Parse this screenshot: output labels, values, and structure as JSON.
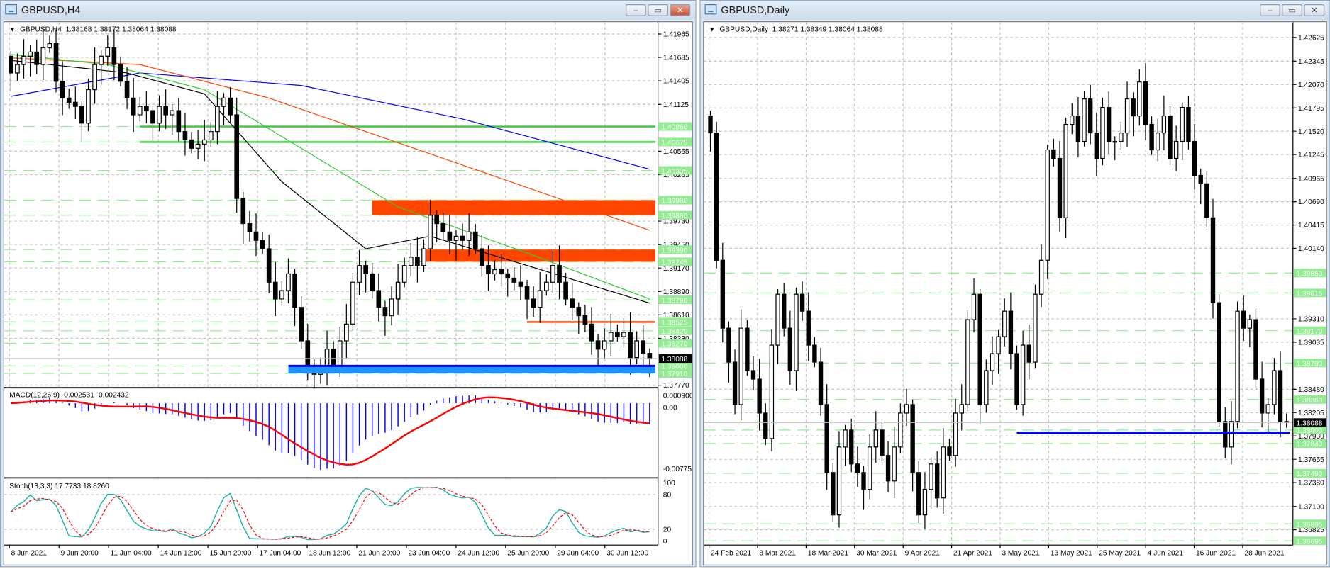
{
  "left_window": {
    "title": "GBPUSD,H4",
    "buttons": {
      "minimize": "–",
      "restore": "▭",
      "close": "✕"
    },
    "header": {
      "symbol": "GBPUSD,H4",
      "ohlc": "1.38168 1.38172 1.38064 1.38088"
    },
    "macd_label": "MACD(12,26,9) -0.002531 -0.002432",
    "stoch_label": "Stoch(13,3,3) 17.7733 18.8260"
  },
  "right_window": {
    "title": "GBPUSD,Daily",
    "buttons": {
      "minimize": "–",
      "restore": "▭",
      "close": "✕"
    },
    "header": {
      "symbol": "GBPUSD,Daily",
      "ohlc": "1.38271 1.38349 1.38064 1.38088"
    }
  },
  "colors": {
    "bull": "#ffffff",
    "bear": "#000000",
    "grid": "#c0c0c0",
    "level": "#90ee90",
    "zone": "#ff4500",
    "support": "#0000ff",
    "ma_blue": "#0000ff",
    "ma_red": "#ff4500",
    "ma_green": "#32cd32",
    "ma_black": "#000000",
    "macd_hist": "#0000ff",
    "macd_signal": "#ff0000",
    "stoch_main": "#20b2aa",
    "stoch_signal": "#ff0000"
  },
  "chart_data": [
    {
      "type": "candlestick",
      "title": "GBPUSD,H4",
      "ylim": [
        1.3777,
        1.41965
      ],
      "y_ticks": [
        "1.41965",
        "1.41685",
        "1.41405",
        "1.41125",
        "1.40565",
        "1.40285",
        "1.39730",
        "1.39450",
        "1.39170",
        "1.38890",
        "1.38610",
        "1.38330",
        "1.37770"
      ],
      "level_labels": [
        "1.40860",
        "1.40675",
        "1.40335",
        "1.39980",
        "1.39800",
        "1.39390",
        "1.39245",
        "1.38790",
        "1.38525",
        "1.38420",
        "1.38270",
        "1.38000",
        "1.37910"
      ],
      "current_price": "1.38088",
      "x_labels": [
        "8 Jun 2021",
        "9 Jun 20:00",
        "11 Jun 04:00",
        "14 Jun 12:00",
        "15 Jun 20:00",
        "17 Jun 04:00",
        "18 Jun 12:00",
        "21 Jun 20:00",
        "23 Jun 04:00",
        "24 Jun 12:00",
        "25 Jun 20:00",
        "29 Jun 04:00",
        "30 Jun 12:00"
      ],
      "closes": [
        1.415,
        1.416,
        1.417,
        1.4175,
        1.416,
        1.418,
        1.4185,
        1.414,
        1.412,
        1.4115,
        1.411,
        1.409,
        1.413,
        1.416,
        1.417,
        1.418,
        1.416,
        1.414,
        1.412,
        1.41,
        1.411,
        1.4105,
        1.409,
        1.411,
        1.41,
        1.4105,
        1.408,
        1.407,
        1.406,
        1.4065,
        1.407,
        1.408,
        1.411,
        1.412,
        1.41,
        1.4,
        1.397,
        1.396,
        1.395,
        1.394,
        1.39,
        1.388,
        1.389,
        1.391,
        1.387,
        1.383,
        1.38,
        1.379,
        1.3795,
        1.382,
        1.38,
        1.383,
        1.385,
        1.39,
        1.392,
        1.391,
        1.389,
        1.387,
        1.386,
        1.388,
        1.39,
        1.392,
        1.393,
        1.392,
        1.394,
        1.398,
        1.397,
        1.396,
        1.395,
        1.3955,
        1.395,
        1.396,
        1.394,
        1.392,
        1.391,
        1.3915,
        1.391,
        1.3905,
        1.39,
        1.3895,
        1.388,
        1.387,
        1.389,
        1.39,
        1.392,
        1.39,
        1.388,
        1.387,
        1.386,
        1.385,
        1.383,
        1.382,
        1.383,
        1.384,
        1.3835,
        1.384,
        1.381,
        1.383,
        1.3815,
        1.38088
      ],
      "moving_averages": [
        {
          "name": "blue",
          "points": [
            [
              0,
              1.4122
            ],
            [
              20,
              1.415
            ],
            [
              45,
              1.4135
            ],
            [
              70,
              1.4095
            ],
            [
              99,
              1.4035
            ]
          ]
        },
        {
          "name": "red",
          "points": [
            [
              0,
              1.4168
            ],
            [
              20,
              1.416
            ],
            [
              40,
              1.412
            ],
            [
              70,
              1.404
            ],
            [
              99,
              1.3962
            ]
          ]
        },
        {
          "name": "green",
          "points": [
            [
              0,
              1.4172
            ],
            [
              15,
              1.416
            ],
            [
              30,
              1.413
            ],
            [
              45,
              1.406
            ],
            [
              60,
              1.399
            ],
            [
              80,
              1.3935
            ],
            [
              99,
              1.388
            ]
          ]
        },
        {
          "name": "black",
          "points": [
            [
              0,
              1.4165
            ],
            [
              18,
              1.415
            ],
            [
              30,
              1.4125
            ],
            [
              42,
              1.402
            ],
            [
              55,
              1.394
            ],
            [
              65,
              1.3955
            ],
            [
              80,
              1.392
            ],
            [
              99,
              1.3875
            ]
          ]
        }
      ],
      "levels": [
        {
          "price": 1.4086,
          "kind": "solid-green",
          "from": 20
        },
        {
          "price": 1.40675,
          "kind": "solid-green",
          "from": 20
        },
        {
          "price": 1.38525,
          "kind": "orange-line",
          "from": 80
        }
      ],
      "zones": [
        {
          "low": 1.398,
          "high": 1.3998,
          "from": 56
        },
        {
          "low": 1.39245,
          "high": 1.3939,
          "from": 64
        }
      ],
      "support": {
        "low": 1.3791,
        "high": 1.38,
        "from": 43
      },
      "macd": {
        "params": [
          12,
          26,
          9
        ],
        "ylim": [
          -0.007758,
          0.000906
        ],
        "ticks": [
          "0.000906",
          "0.00",
          "-0.007758"
        ]
      },
      "stoch": {
        "params": [
          13,
          3,
          3
        ],
        "ticks": [
          "100",
          "80",
          "20",
          "0"
        ]
      }
    },
    {
      "type": "candlestick",
      "title": "GBPUSD,Daily",
      "ylim": [
        1.36695,
        1.42625
      ],
      "y_ticks": [
        "1.42625",
        "1.42345",
        "1.42070",
        "1.41795",
        "1.41520",
        "1.41245",
        "1.40965",
        "1.40690",
        "1.40415",
        "1.40140",
        "1.39310",
        "1.39035",
        "1.38480",
        "1.38205",
        "1.37930",
        "1.37655",
        "1.37380",
        "1.37100",
        "1.36825"
      ],
      "level_labels": [
        "1.39850",
        "1.39615",
        "1.39170",
        "1.38790",
        "1.38360",
        "1.38000",
        "1.37840",
        "1.37490",
        "1.36895",
        "1.36695"
      ],
      "current_price": "1.38088",
      "x_labels": [
        "24 Feb 2021",
        "8 Mar 2021",
        "18 Mar 2021",
        "30 Mar 2021",
        "9 Apr 2021",
        "21 Apr 2021",
        "3 May 2021",
        "13 May 2021",
        "25 May 2021",
        "4 Jun 2021",
        "16 Jun 2021",
        "28 Jun 2021"
      ],
      "closes": [
        1.415,
        1.4,
        1.392,
        1.388,
        1.383,
        1.392,
        1.387,
        1.386,
        1.382,
        1.379,
        1.39,
        1.396,
        1.392,
        1.387,
        1.396,
        1.394,
        1.39,
        1.388,
        1.383,
        1.375,
        1.37,
        1.378,
        1.38,
        1.376,
        1.375,
        1.373,
        1.378,
        1.38,
        1.377,
        1.374,
        1.378,
        1.382,
        1.383,
        1.375,
        1.37,
        1.373,
        1.376,
        1.372,
        1.378,
        1.377,
        1.382,
        1.383,
        1.393,
        1.396,
        1.383,
        1.387,
        1.389,
        1.391,
        1.394,
        1.389,
        1.383,
        1.39,
        1.388,
        1.396,
        1.4,
        1.413,
        1.412,
        1.405,
        1.416,
        1.417,
        1.414,
        1.419,
        1.415,
        1.412,
        1.418,
        1.414,
        1.414,
        1.415,
        1.419,
        1.417,
        1.421,
        1.416,
        1.413,
        1.415,
        1.417,
        1.412,
        1.414,
        1.418,
        1.414,
        1.41,
        1.409,
        1.405,
        1.395,
        1.381,
        1.378,
        1.381,
        1.394,
        1.392,
        1.393,
        1.386,
        1.382,
        1.383,
        1.387,
        1.381,
        1.38088
      ],
      "support": {
        "price": 1.3797,
        "from": 50
      }
    }
  ]
}
